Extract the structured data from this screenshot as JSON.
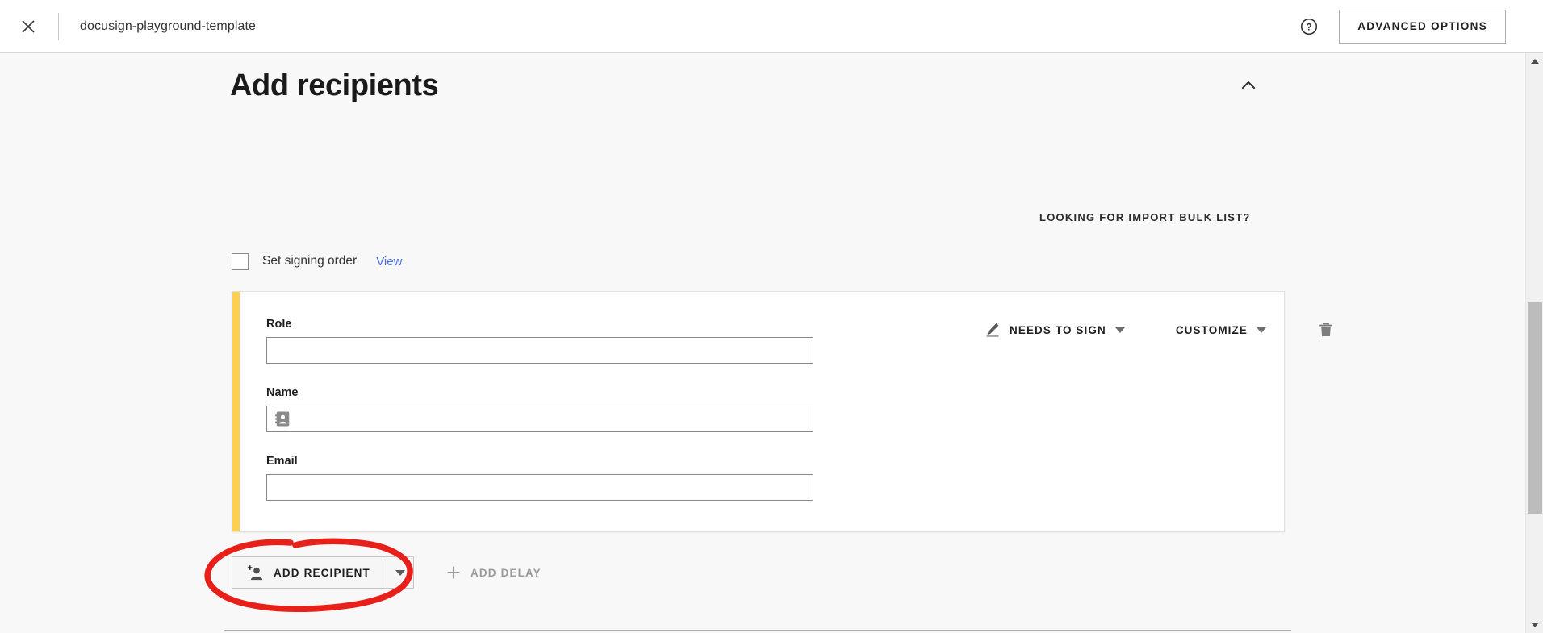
{
  "header": {
    "close_icon": "close-icon",
    "document_title": "docusign-playground-template",
    "help_icon": "help-circle-icon",
    "advanced_options_label": "ADVANCED OPTIONS"
  },
  "section": {
    "title": "Add recipients",
    "collapse_icon": "chevron-up-icon",
    "bulk_list_link": "LOOKING FOR IMPORT BULK LIST?"
  },
  "signing_order": {
    "checkbox_checked": false,
    "label": "Set signing order",
    "view_link": "View"
  },
  "recipient": {
    "accent_color": "#ffcf4f",
    "fields": [
      {
        "label": "Role",
        "value": "",
        "placeholder": "",
        "icon": null
      },
      {
        "label": "Name",
        "value": "",
        "placeholder": "",
        "icon": "contact-card-icon"
      },
      {
        "label": "Email",
        "value": "",
        "placeholder": "",
        "icon": null
      }
    ],
    "role_label": "Role",
    "name_label": "Name",
    "email_label": "Email",
    "role_value": "",
    "name_value": "",
    "email_value": "",
    "action_icon": "pen-signature-icon",
    "action_label": "NEEDS TO SIGN",
    "customize_label": "CUSTOMIZE",
    "delete_icon": "trash-icon"
  },
  "actions": {
    "add_recipient_icon": "person-plus-icon",
    "add_recipient_label": "ADD RECIPIENT",
    "add_recipient_caret_icon": "caret-down-icon",
    "add_delay_icon": "plus-icon",
    "add_delay_label": "ADD DELAY",
    "add_delay_disabled": true
  },
  "annotation": {
    "type": "hand-drawn-ellipse",
    "color": "#e8201a",
    "target": "ADD RECIPIENT"
  },
  "scrollbar": {
    "up_arrow_icon": "scroll-up-icon",
    "down_arrow_icon": "scroll-down-icon"
  },
  "colors": {
    "accent_yellow": "#ffcf4f",
    "link_blue": "#4a6fe3",
    "annotation_red": "#e8201a",
    "page_background": "#f8f8f8",
    "disabled_gray": "#9b9b9b"
  }
}
